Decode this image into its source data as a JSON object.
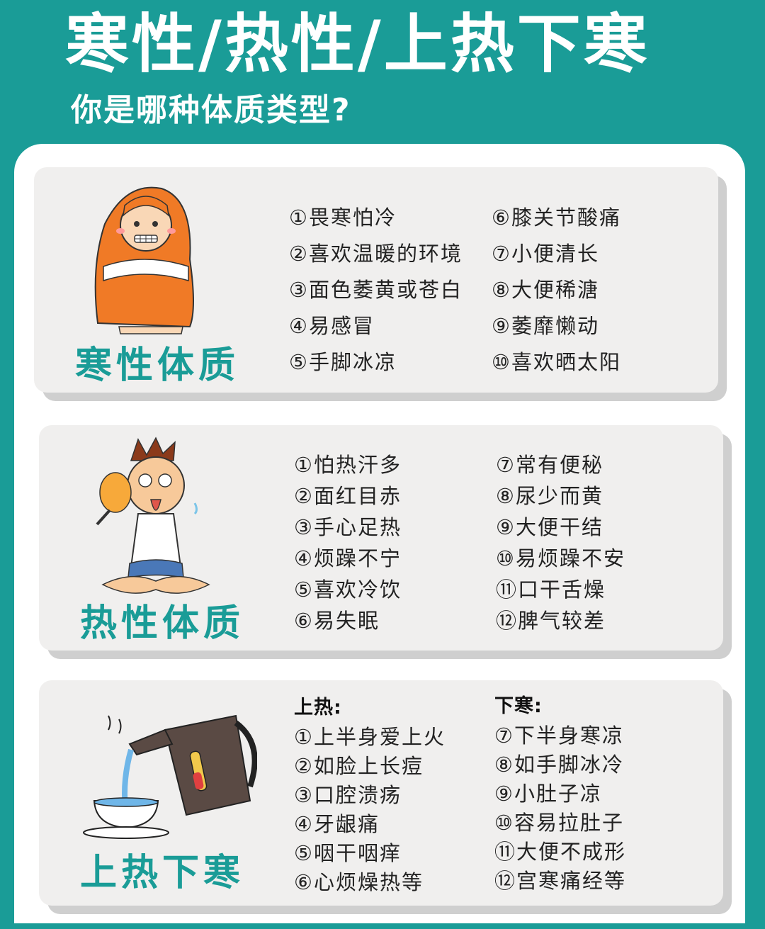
{
  "title": "寒性/热性/上热下寒",
  "subtitle": "你是哪种体质类型?",
  "sections": [
    {
      "label": "寒性体质",
      "illustration": "cold-person-blanket-icon",
      "left": [
        "①畏寒怕冷",
        "②喜欢温暖的环境",
        "③面色萎黄或苍白",
        "④易感冒",
        "⑤手脚冰凉"
      ],
      "right": [
        "⑥膝关节酸痛",
        "⑦小便清长",
        "⑧大便稀溏",
        "⑨萎靡懒动",
        "⑩喜欢晒太阳"
      ]
    },
    {
      "label": "热性体质",
      "illustration": "hot-sweating-person-icon",
      "left": [
        "①怕热汗多",
        "②面红目赤",
        "③手心足热",
        "④烦躁不宁",
        "⑤喜欢冷饮",
        "⑥易失眠"
      ],
      "right": [
        "⑦常有便秘",
        "⑧尿少而黄",
        "⑨大便干结",
        "⑩易烦躁不安",
        "⑪口干舌燥",
        "⑫脾气较差"
      ]
    },
    {
      "label": "上热下寒",
      "illustration": "kettle-pouring-cup-icon",
      "left_heading": "上热:",
      "right_heading": "下寒:",
      "left": [
        "①上半身爱上火",
        "②如脸上长痘",
        "③口腔溃疡",
        "④牙龈痛",
        "⑤咽干咽痒",
        "⑥心烦燥热等"
      ],
      "right": [
        "⑦下半身寒凉",
        "⑧如手脚冰冷",
        "⑨小肚子凉",
        "⑩容易拉肚子",
        "⑪大便不成形",
        "⑫宫寒痛经等"
      ]
    }
  ],
  "colors": {
    "background": "#1a9c97",
    "accent": "#1a9c97",
    "card": "#f0efee"
  }
}
